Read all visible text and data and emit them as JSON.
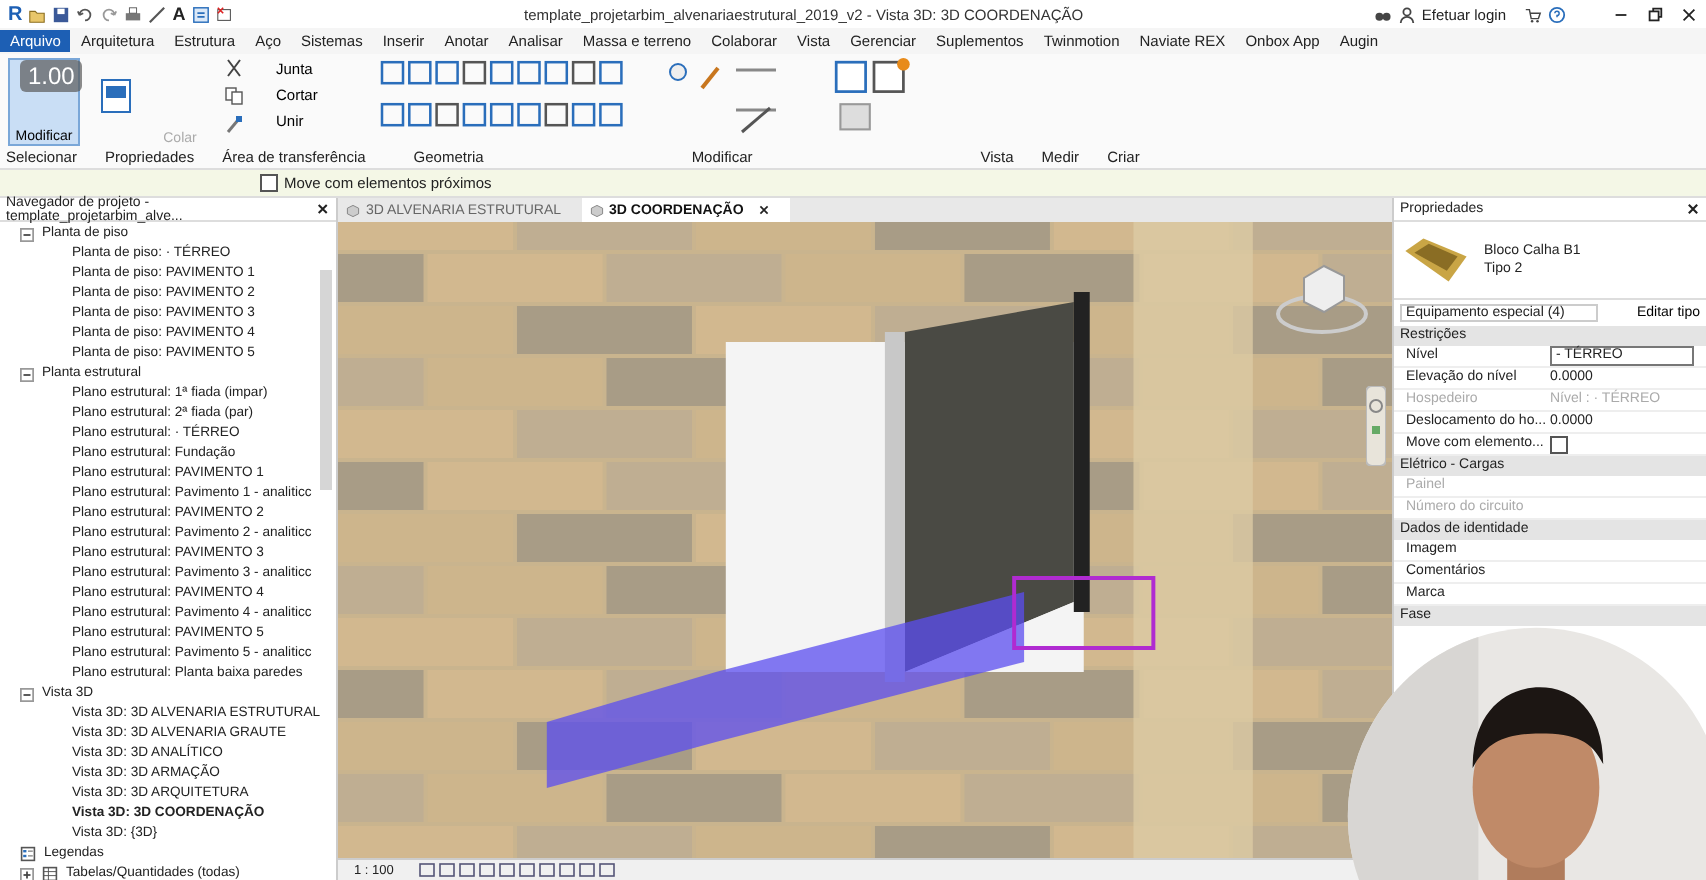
{
  "window": {
    "app_logo": "R",
    "title": "template_projetarbim_alvenariaestrutural_2019_v2 - Vista 3D: 3D COORDENAÇÃO",
    "login": "Efetuar login"
  },
  "toolbar_text_icon": "A",
  "ribbon_tabs": [
    {
      "label": "Arquivo",
      "selected": true
    },
    {
      "label": "Arquitetura",
      "selected": false
    },
    {
      "label": "Estrutura",
      "selected": false
    },
    {
      "label": "Aço",
      "selected": false
    },
    {
      "label": "Sistemas",
      "selected": false
    },
    {
      "label": "Inserir",
      "selected": false
    },
    {
      "label": "Anotar",
      "selected": false
    },
    {
      "label": "Analisar",
      "selected": false
    },
    {
      "label": "Massa e terreno",
      "selected": false
    },
    {
      "label": "Colaborar",
      "selected": false
    },
    {
      "label": "Vista",
      "selected": false
    },
    {
      "label": "Gerenciar",
      "selected": false
    },
    {
      "label": "Suplementos",
      "selected": false
    },
    {
      "label": "Twinmotion",
      "selected": false
    },
    {
      "label": "Naviate REX",
      "selected": false
    },
    {
      "label": "Onbox App",
      "selected": false
    },
    {
      "label": "Augin",
      "selected": false
    }
  ],
  "ribbon": {
    "modify_button": {
      "label": "Modificar",
      "selected": true
    },
    "playback_speed": "1.00",
    "paste": {
      "label": "Colar",
      "disabled": true
    },
    "geometry_buttons": [
      "Junta",
      "Cortar",
      "Unir"
    ],
    "panels": [
      "Selecionar",
      "Propriedades",
      "Área de transferência",
      "Geometria",
      "Modificar",
      "Vista",
      "Medir",
      "Criar"
    ]
  },
  "options_bar": {
    "label": "Move com elementos próximos",
    "checked": false
  },
  "browser": {
    "title": "Navegador de projeto - template_projetarbim_alve...",
    "items": [
      {
        "label": "Planta de piso",
        "expanded": true,
        "children": [
          {
            "label": "Planta de piso: · TÉRREO",
            "selected": false
          },
          {
            "label": "Planta de piso: PAVIMENTO 1",
            "selected": false
          },
          {
            "label": "Planta de piso: PAVIMENTO 2",
            "selected": false
          },
          {
            "label": "Planta de piso: PAVIMENTO 3",
            "selected": false
          },
          {
            "label": "Planta de piso: PAVIMENTO 4",
            "selected": false
          },
          {
            "label": "Planta de piso: PAVIMENTO 5",
            "selected": false
          }
        ]
      },
      {
        "label": "Planta estrutural",
        "expanded": true,
        "children": [
          {
            "label": "Plano estrutural: 1ª fiada (impar)",
            "selected": false
          },
          {
            "label": "Plano estrutural: 2ª fiada (par)",
            "selected": false
          },
          {
            "label": "Plano estrutural: · TÉRREO",
            "selected": false
          },
          {
            "label": "Plano estrutural: Fundação",
            "selected": false
          },
          {
            "label": "Plano estrutural: PAVIMENTO 1",
            "selected": false
          },
          {
            "label": "Plano estrutural: Pavimento 1 - analiticc",
            "selected": false
          },
          {
            "label": "Plano estrutural: PAVIMENTO 2",
            "selected": false
          },
          {
            "label": "Plano estrutural: Pavimento 2 - analiticc",
            "selected": false
          },
          {
            "label": "Plano estrutural: PAVIMENTO 3",
            "selected": false
          },
          {
            "label": "Plano estrutural: Pavimento 3 - analiticc",
            "selected": false
          },
          {
            "label": "Plano estrutural: PAVIMENTO 4",
            "selected": false
          },
          {
            "label": "Plano estrutural: Pavimento 4 - analiticc",
            "selected": false
          },
          {
            "label": "Plano estrutural: PAVIMENTO 5",
            "selected": false
          },
          {
            "label": "Plano estrutural: Pavimento 5 - analiticc",
            "selected": false
          },
          {
            "label": "Plano estrutural: Planta baixa paredes",
            "selected": false
          }
        ]
      },
      {
        "label": "Vista 3D",
        "expanded": true,
        "children": [
          {
            "label": "Vista 3D: 3D ALVENARIA ESTRUTURAL",
            "selected": false
          },
          {
            "label": "Vista 3D: 3D ALVENARIA GRAUTE",
            "selected": false
          },
          {
            "label": "Vista 3D: 3D ANALÍTICO",
            "selected": false
          },
          {
            "label": "Vista 3D: 3D ARMAÇÃO",
            "selected": false
          },
          {
            "label": "Vista 3D: 3D ARQUITETURA",
            "selected": false
          },
          {
            "label": "Vista 3D: 3D COORDENAÇÃO",
            "selected": true
          },
          {
            "label": "Vista 3D: {3D}",
            "selected": false
          }
        ]
      },
      {
        "label": "Legendas",
        "kind": "legend"
      },
      {
        "label": "Tabelas/Quantidades (todas)",
        "kind": "schedule",
        "expanded": false
      }
    ]
  },
  "view_tabs": [
    {
      "label": "3D ALVENARIA ESTRUTURAL",
      "selected": false
    },
    {
      "label": "3D COORDENAÇÃO",
      "selected": true
    }
  ],
  "view_status": {
    "scale": "1 : 100"
  },
  "properties": {
    "title": "Propriedades",
    "family": "Bloco Calha B1",
    "type": "Tipo 2",
    "category": "Equipamento especial (4)",
    "edit_type": "Editar tipo",
    "sections": [
      {
        "label": "Restrições",
        "rows": [
          {
            "kind": "input",
            "name": "Nível",
            "value": "- TÉRREO",
            "disabled": false
          },
          {
            "kind": "text",
            "name": "Elevação do nível",
            "value": "0.0000",
            "disabled": false
          },
          {
            "kind": "text",
            "name": "Hospedeiro",
            "value": "Nível : · TÉRREO",
            "disabled": true
          },
          {
            "kind": "text",
            "name": "Deslocamento do ho...",
            "value": "0.0000",
            "disabled": false
          },
          {
            "kind": "checkbox",
            "name": "Move com elemento...",
            "checked": false,
            "disabled": false
          }
        ]
      },
      {
        "label": "Elétrico - Cargas",
        "rows": [
          {
            "kind": "text",
            "name": "Painel",
            "disabled": true
          },
          {
            "kind": "text",
            "name": "Número do circuito",
            "disabled": true
          }
        ]
      },
      {
        "label": "Dados de identidade",
        "rows": [
          {
            "kind": "text",
            "name": "Imagem",
            "disabled": false
          },
          {
            "kind": "text",
            "name": "Comentários",
            "disabled": false
          },
          {
            "kind": "text",
            "name": "Marca",
            "disabled": false
          }
        ]
      },
      {
        "label": "Fase"
      }
    ]
  }
}
